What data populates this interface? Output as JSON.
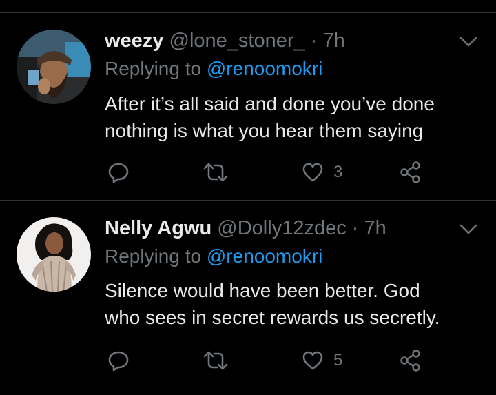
{
  "tweets": [
    {
      "name": "weezy",
      "handle": "@lone_stoner_",
      "separator": "·",
      "time": "7h",
      "replying_prefix": "Replying to",
      "replying_to": "@renoomokri",
      "text_lines": [
        "After it’s all said and done you’ve done",
        "nothing is what you hear them saying"
      ],
      "like_count": "3",
      "icons": [
        "reply-icon",
        "retweet-icon",
        "heart-icon",
        "share-icon",
        "chevron-down-icon"
      ]
    },
    {
      "name": "Nelly Agwu",
      "handle": "@Dolly12zdec",
      "separator": "·",
      "time": "7h",
      "replying_prefix": "Replying to",
      "replying_to": "@renoomokri",
      "text_lines": [
        "Silence would have been better. God",
        "who sees in secret rewards us secretly."
      ],
      "like_count": "5",
      "icons": [
        "reply-icon",
        "retweet-icon",
        "heart-icon",
        "share-icon",
        "chevron-down-icon"
      ]
    }
  ],
  "colors": {
    "background": "#000000",
    "primary_text": "#e7e9ea",
    "secondary_text": "#71767b",
    "link": "#1d9bf0",
    "divider": "#2f3336"
  }
}
